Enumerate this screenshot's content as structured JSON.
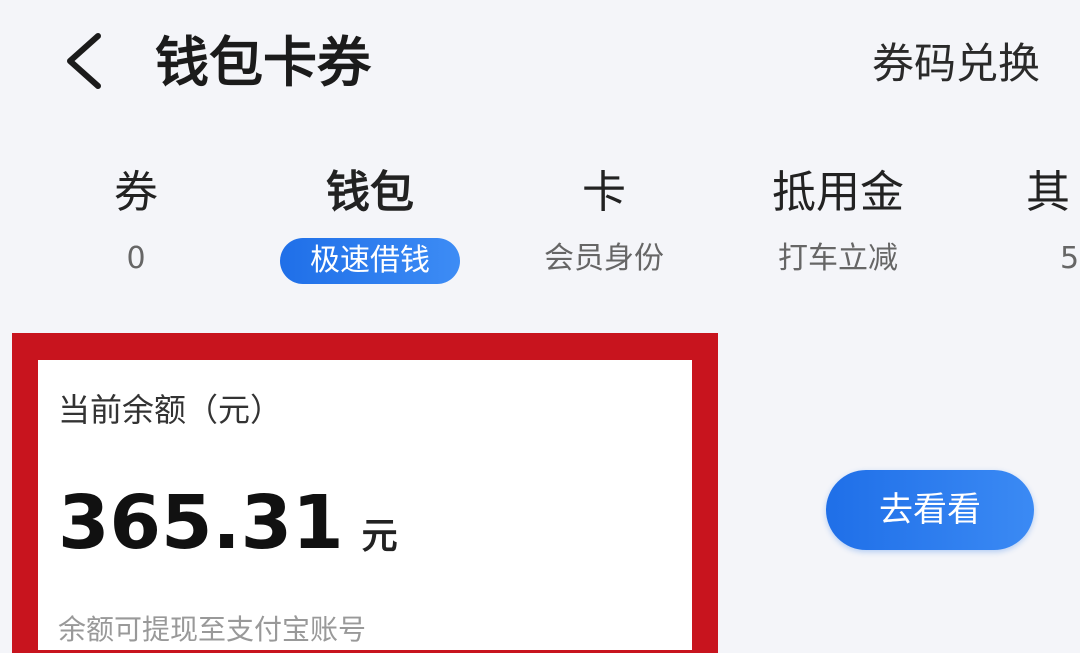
{
  "header": {
    "back_icon": "chevron-left-icon",
    "title": "钱包卡券",
    "redeem_label": "券码兑换"
  },
  "tabs": [
    {
      "label": "券",
      "sub": "0",
      "active": false
    },
    {
      "label": "钱包",
      "sub": "极速借钱",
      "active": true
    },
    {
      "label": "卡",
      "sub": "会员身份",
      "active": false
    },
    {
      "label": "抵用金",
      "sub": "打车立减",
      "active": false
    },
    {
      "label": "其",
      "sub": "5",
      "active": false
    }
  ],
  "balance": {
    "label": "当前余额（元）",
    "amount": "365.31",
    "unit": "元",
    "note": "余额可提现至支付宝账号"
  },
  "actions": {
    "go_label": "去看看"
  },
  "colors": {
    "accent": "#1f6fe8",
    "highlight_frame": "#c8141e",
    "background": "#f4f5f9"
  }
}
